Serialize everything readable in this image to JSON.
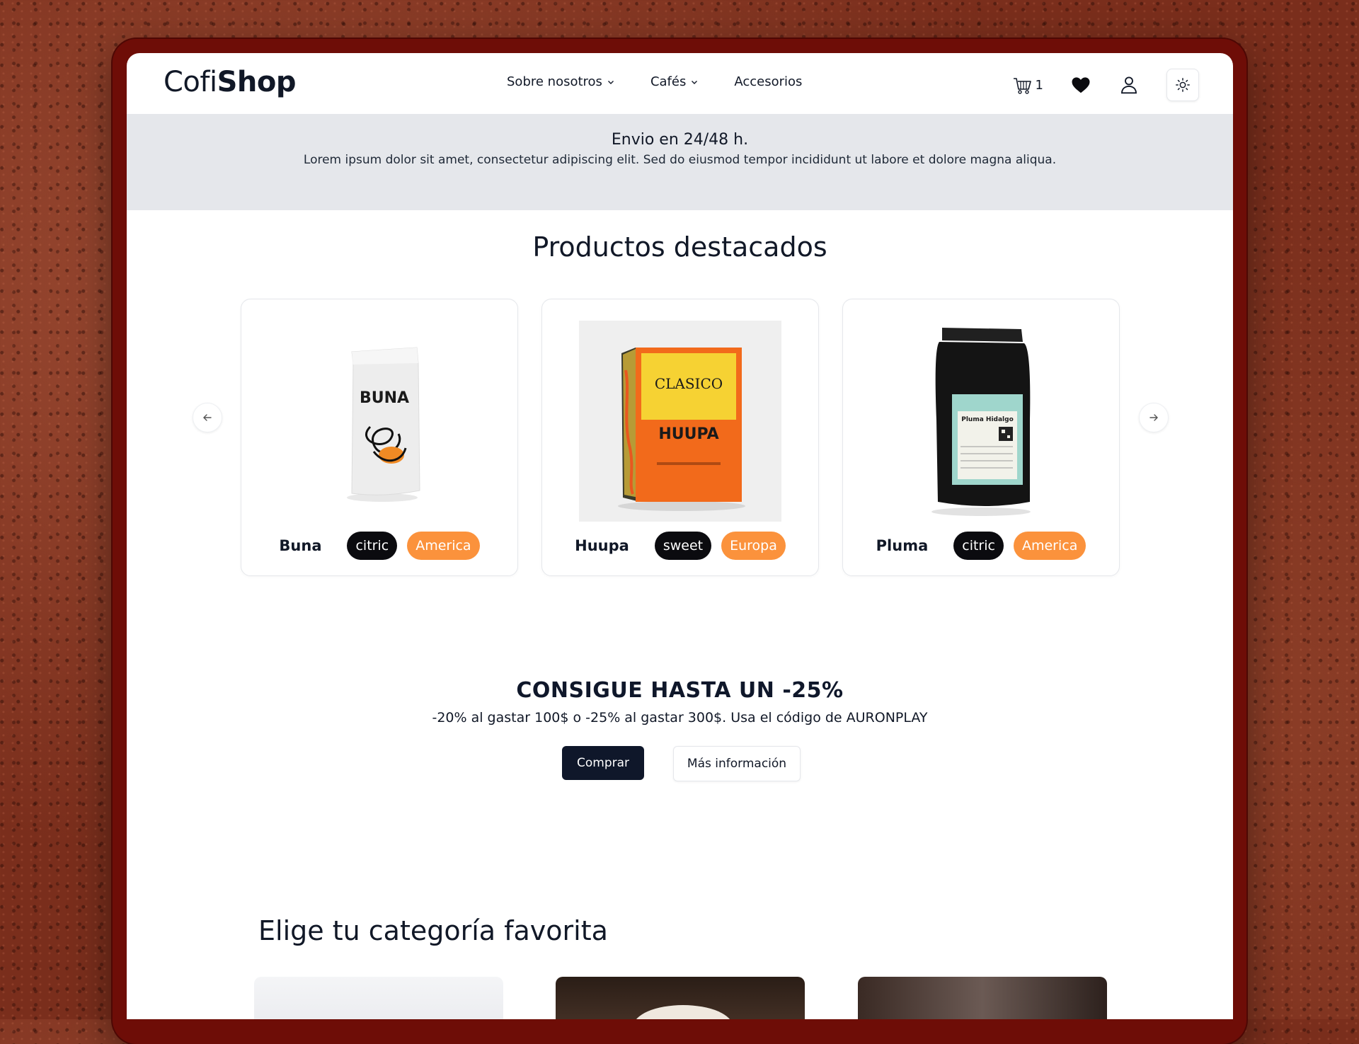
{
  "header": {
    "logo_light": "Cofi",
    "logo_bold": "Shop",
    "nav": [
      {
        "label": "Sobre nosotros",
        "dropdown": true
      },
      {
        "label": "Cafés",
        "dropdown": true
      },
      {
        "label": "Accesorios",
        "dropdown": false
      }
    ],
    "cart_count": "1"
  },
  "banner": {
    "title": "Envio en 24/48 h.",
    "text": "Lorem ipsum dolor sit amet, consectetur adipiscing elit. Sed do eiusmod tempor incididunt ut labore et dolore magna aliqua."
  },
  "featured": {
    "title": "Productos destacados",
    "products": [
      {
        "name": "Buna",
        "flavor": "citric",
        "origin": "America",
        "bag_label": "BUNA"
      },
      {
        "name": "Huupa",
        "flavor": "sweet",
        "origin": "Europa",
        "bag_label": "HUUPA",
        "bag_sub": "CLASICO"
      },
      {
        "name": "Pluma",
        "flavor": "citric",
        "origin": "America",
        "bag_label": "Pluma Hidalgo"
      }
    ]
  },
  "promo": {
    "title": "CONSIGUE HASTA UN -25%",
    "text": "-20% al gastar 100$ o -25% al gastar 300$. Usa el código de AURONPLAY",
    "buy_label": "Comprar",
    "info_label": "Más información"
  },
  "categories": {
    "title": "Elige tu categoría favorita"
  },
  "colors": {
    "accent_orange": "#fb923c",
    "dark": "#0f172a",
    "banner_gray": "#e5e7eb",
    "frame": "#6e0d07"
  }
}
